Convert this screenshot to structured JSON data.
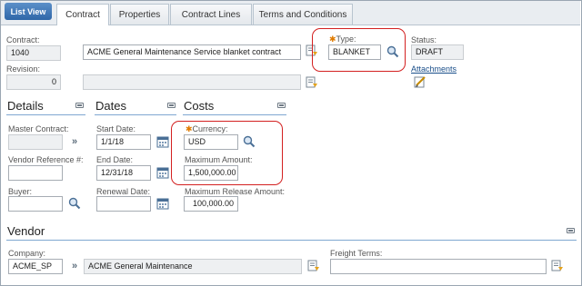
{
  "toolbar": {
    "list_view": "List View"
  },
  "tabs": [
    {
      "label": "Contract"
    },
    {
      "label": "Properties"
    },
    {
      "label": "Contract Lines"
    },
    {
      "label": "Terms and Conditions"
    }
  ],
  "header": {
    "contract_label": "Contract:",
    "contract_value": "1040",
    "description_value": "ACME General Maintenance Service blanket contract",
    "type_label": "Type:",
    "type_value": "BLANKET",
    "status_label": "Status:",
    "status_value": "DRAFT",
    "revision_label": "Revision:",
    "revision_value": "0",
    "attachments_label": "Attachments"
  },
  "details": {
    "title": "Details",
    "master_contract_label": "Master Contract:",
    "master_contract_value": "",
    "vendor_reference_label": "Vendor Reference #:",
    "vendor_reference_value": "",
    "buyer_label": "Buyer:",
    "buyer_value": ""
  },
  "dates": {
    "title": "Dates",
    "start_label": "Start Date:",
    "start_value": "1/1/18",
    "end_label": "End Date:",
    "end_value": "12/31/18",
    "renewal_label": "Renewal Date:",
    "renewal_value": ""
  },
  "costs": {
    "title": "Costs",
    "currency_label": "Currency:",
    "currency_value": "USD",
    "max_amount_label": "Maximum Amount:",
    "max_amount_value": "1,500,000.00",
    "max_release_label": "Maximum Release Amount:",
    "max_release_value": "100,000.00"
  },
  "vendor": {
    "title": "Vendor",
    "company_label": "Company:",
    "company_value": "ACME_SP",
    "company_name_value": "ACME General Maintenance",
    "freight_label": "Freight Terms:",
    "freight_value": ""
  },
  "colors": {
    "accent": "#2f67a8",
    "required_star": "#e07b00",
    "highlight_box": "#d32020",
    "section_rule": "#7fa7d1"
  },
  "icons": [
    "magnifier-icon",
    "detail-menu-icon",
    "calendar-icon",
    "attachments-icon",
    "collapse-icon"
  ]
}
